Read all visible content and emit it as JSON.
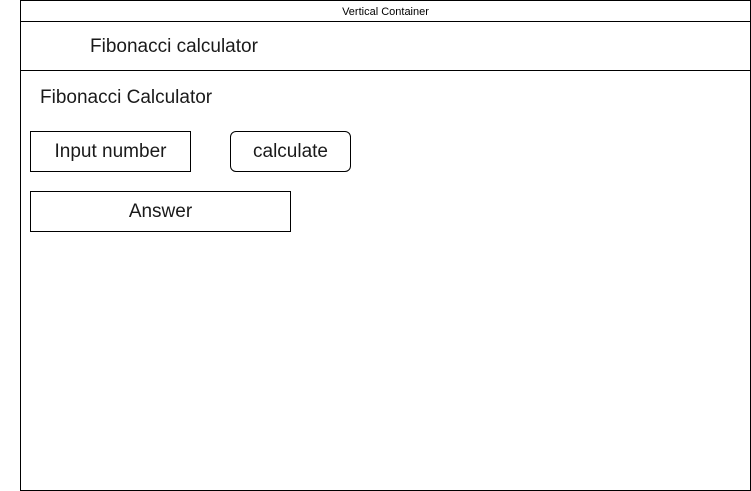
{
  "container": {
    "title": "Vertical Container"
  },
  "header": {
    "title": "Fibonacci calculator"
  },
  "main": {
    "section_title": "Fibonacci Calculator",
    "input_placeholder": "Input number",
    "calculate_label": "calculate",
    "answer_label": "Answer"
  }
}
